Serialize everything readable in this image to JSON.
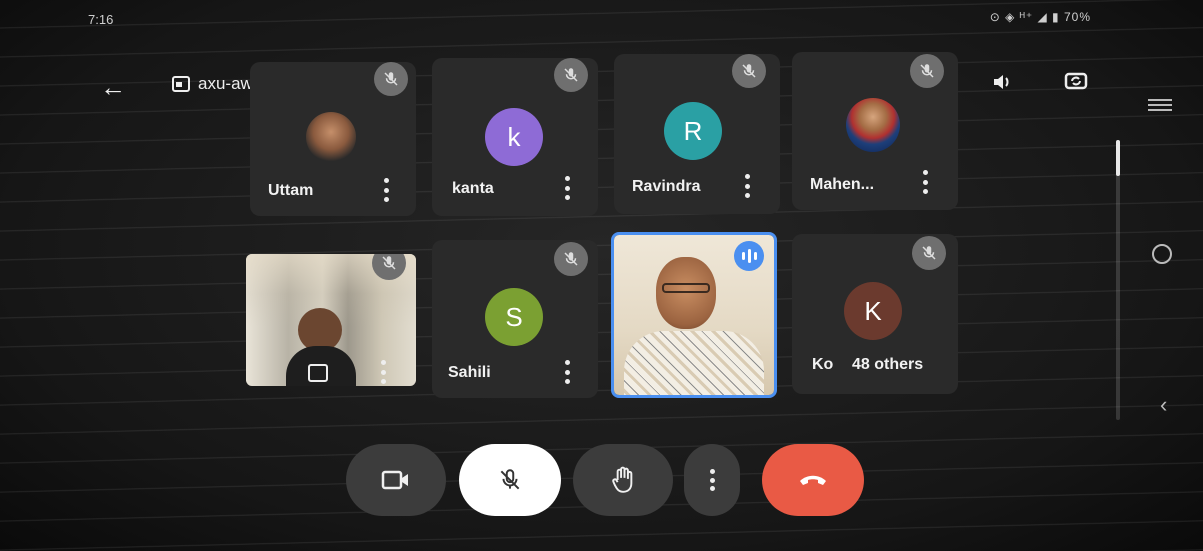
{
  "status_bar": {
    "time": "7:16",
    "right": "⊙ ◈ ᴴ⁺ ◢ ▮ 70%"
  },
  "header": {
    "meeting_code": "axu-awzf-xie"
  },
  "participants": [
    {
      "name": "Uttam"
    },
    {
      "name": "kanta",
      "initial": "k",
      "color": "#8e6bd6"
    },
    {
      "name": "Ravindra",
      "initial": "R",
      "color": "#2aa0a4"
    },
    {
      "name": "Mahen..."
    },
    {
      "name": ""
    },
    {
      "name": "Sahili",
      "initial": "S",
      "color": "#7ba032"
    },
    {
      "name": ""
    },
    {
      "name": "Ko",
      "initial": "K",
      "color": "#6b3a2e",
      "others": "48 others"
    }
  ],
  "icons": {
    "back": "arrow-left-icon",
    "meeting": "calendar-icon",
    "speaker": "speaker-icon",
    "switch_camera": "switch-camera-icon",
    "mic_off": "mic-off-icon",
    "speaking": "speaking-indicator-icon",
    "camera": "camera-icon",
    "hand": "raise-hand-icon",
    "more": "more-vertical-icon",
    "end_call": "end-call-icon",
    "nav_menu": "menu-icon",
    "nav_home": "home-icon",
    "nav_back": "chevron-left-icon"
  },
  "colors": {
    "active_border": "#4a8ff0",
    "speaking_badge": "#4a8ff0",
    "end_call": "#e95a45",
    "mic_button": "#ffffff",
    "control_bg": "#3c3c3c",
    "mute_badge": "#6f6f6f"
  }
}
